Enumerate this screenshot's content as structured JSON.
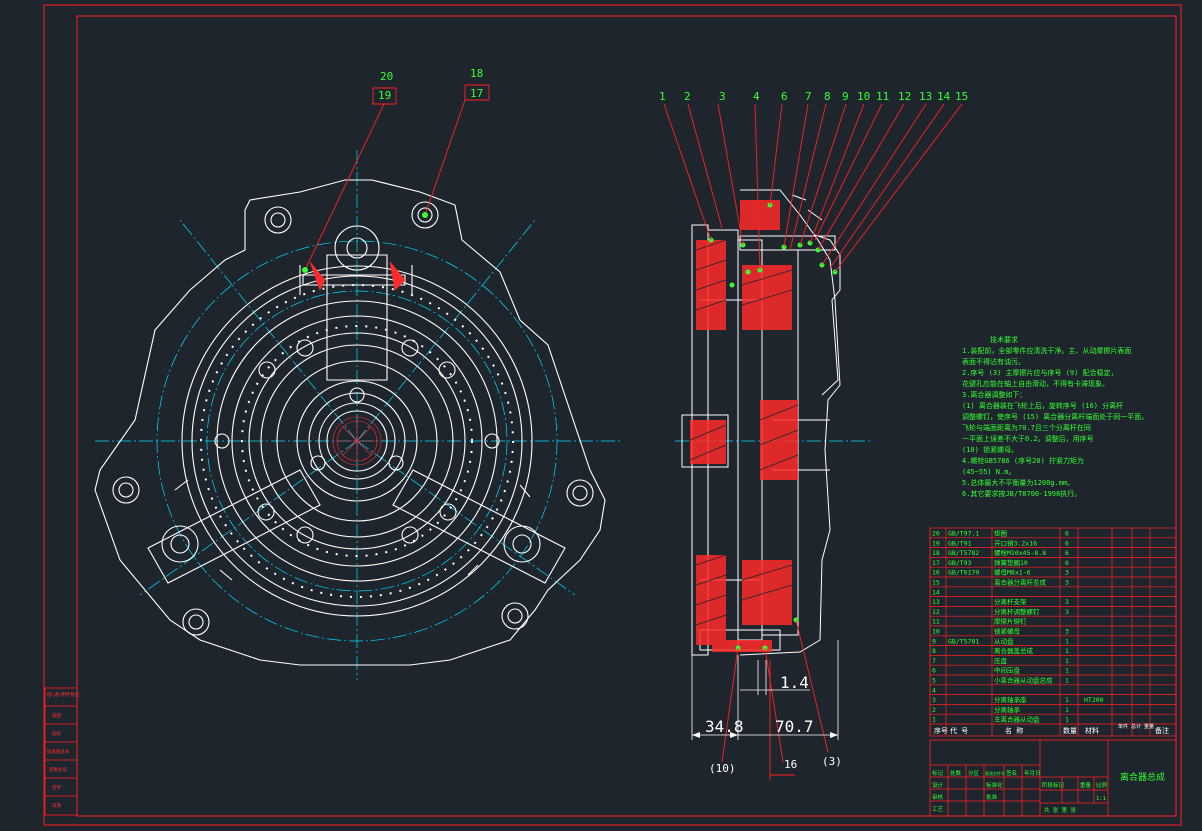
{
  "colors": {
    "background": "#1f252d",
    "frame": "#ff2020",
    "geometry": "#ffffff",
    "centerline": "#00d8ff",
    "text": "#33ff33",
    "section": "#ff2a2a",
    "dim": "#ffffff"
  },
  "front_view": {
    "callouts": [
      {
        "top": "20",
        "bottom": "19"
      },
      {
        "top": "18",
        "bottom": "17"
      }
    ]
  },
  "side_view": {
    "balloons": [
      "1",
      "2",
      "3",
      "4",
      "6",
      "7",
      "8",
      "9",
      "10",
      "11",
      "12",
      "13",
      "14",
      "15"
    ],
    "dimensions": {
      "gap": "1.4",
      "width_a": "34.8",
      "width_b": "70.7"
    },
    "refs": {
      "left": "(10)",
      "middle": "16",
      "right": "(3)"
    }
  },
  "notes": {
    "title": "技术要求",
    "lines": [
      "1.装配前，全部零件应清洗干净。主、从动摩擦片表面",
      "  表面不得沾有油污。",
      "2.序号 (3) 主摩擦片应与序号 (9) 配合稳定，",
      "  花键孔应能在轴上自由滑动，不得有卡滞现象。",
      "3.离合器调整如下：",
      "(1) 离合器装在飞轮上后，旋转序号 (16) 分离杆",
      "  调整螺钉，使序号 (15) 离合器分离杆端面处于同一平面，",
      "  飞轮与端面距离为70.7且三个分离杆在同",
      "  一平面上误差不大于0.2。调整后，用序号",
      "  (10) 锁紧螺母。",
      "4.螺栓GB5786 (序号20) 拧紧力矩为",
      "  (45~55) N.m。",
      "5.总体最大不平衡量为1200g.mm。",
      "6.其它要求按JB/T8700-1998执行。"
    ]
  },
  "bom": {
    "rows": [
      {
        "no": "20",
        "code": "GB/T97.1",
        "name": "垫圈",
        "qty": "6"
      },
      {
        "no": "19",
        "code": "GB/T91",
        "name": "开口销3.2x16",
        "qty": "6"
      },
      {
        "no": "18",
        "code": "GB/T5782",
        "name": "螺栓M10x45-8.8",
        "qty": "6"
      },
      {
        "no": "17",
        "code": "GB/T93",
        "name": "弹簧垫圈10",
        "qty": "6"
      },
      {
        "no": "16",
        "code": "GB/T6170",
        "name": "螺母M8x1-6",
        "qty": "3"
      },
      {
        "no": "15",
        "code": "",
        "name": "离合器分离杆总成",
        "qty": "3"
      },
      {
        "no": "14",
        "code": "",
        "name": "",
        "qty": ""
      },
      {
        "no": "13",
        "code": "",
        "name": "分离杆支架",
        "qty": "3"
      },
      {
        "no": "12",
        "code": "",
        "name": "分离杆调整螺钉",
        "qty": "3"
      },
      {
        "no": "11",
        "code": "",
        "name": "摩擦片铆钉",
        "qty": ""
      },
      {
        "no": "10",
        "code": "",
        "name": "锁紧螺母",
        "qty": "3"
      },
      {
        "no": "9",
        "code": "GB/T5781",
        "name": "从动盘",
        "qty": "1"
      },
      {
        "no": "8",
        "code": "",
        "name": "离合器盖总成",
        "qty": "1"
      },
      {
        "no": "7",
        "code": "",
        "name": "压盘",
        "qty": "1"
      },
      {
        "no": "6",
        "code": "",
        "name": "中间压盘",
        "qty": "1"
      },
      {
        "no": "5",
        "code": "",
        "name": "小离合器从动盘总成",
        "qty": "1"
      },
      {
        "no": "4",
        "code": "",
        "name": "",
        "qty": ""
      },
      {
        "no": "3",
        "code": "",
        "name": "分离轴承座",
        "qty": "1",
        "mat": "HT200"
      },
      {
        "no": "2",
        "code": "",
        "name": "分离轴承",
        "qty": "1"
      },
      {
        "no": "1",
        "code": "",
        "name": "主离合器从动盘",
        "qty": "1"
      }
    ],
    "header": {
      "no": "序号",
      "code": "代  号",
      "name": "名  称",
      "qty": "数量",
      "mat": "材料",
      "weight": "单件 总计 重量",
      "remark": "备注"
    }
  },
  "title_block": {
    "title": "离合器总成",
    "rev_labels": [
      "标记",
      "处数",
      "分区",
      "更改文件号",
      "签名",
      "年月日"
    ],
    "design": "设计",
    "check": "审核",
    "process": "工艺",
    "approve": "批准",
    "standard": "标准化",
    "stage": "阶段标记",
    "mass": "重量",
    "scale": "比例",
    "scale_val": "1:1",
    "sheets": "共  张  第  张"
  },
  "left_strip": [
    "借(通)用件登记",
    "描图",
    "描校",
    "旧底图总号",
    "底图总号",
    "签字",
    "日期"
  ]
}
